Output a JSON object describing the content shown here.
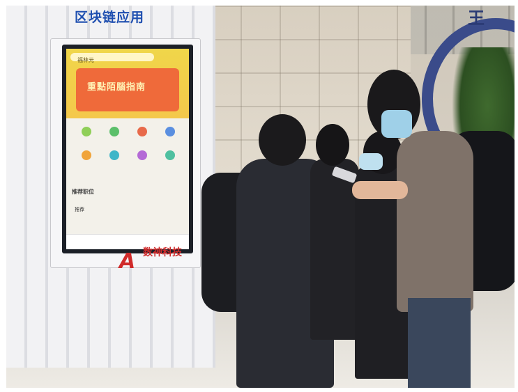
{
  "scene": {
    "kiosk_heading": "区块链应用",
    "screen_banner": "重點陌腦指南",
    "screen_search": "福林元",
    "screen_section": "推荐职位",
    "screen_tab": "推荐",
    "brand_name": "数神科技",
    "arch_sign": "王"
  },
  "colors": {
    "heading_blue": "#1f4fb0",
    "screen_yellow": "#f0d64a",
    "banner_orange": "#ef6a3a",
    "brand_red": "#d02a2a",
    "mask_blue": "#9fd0e8"
  }
}
